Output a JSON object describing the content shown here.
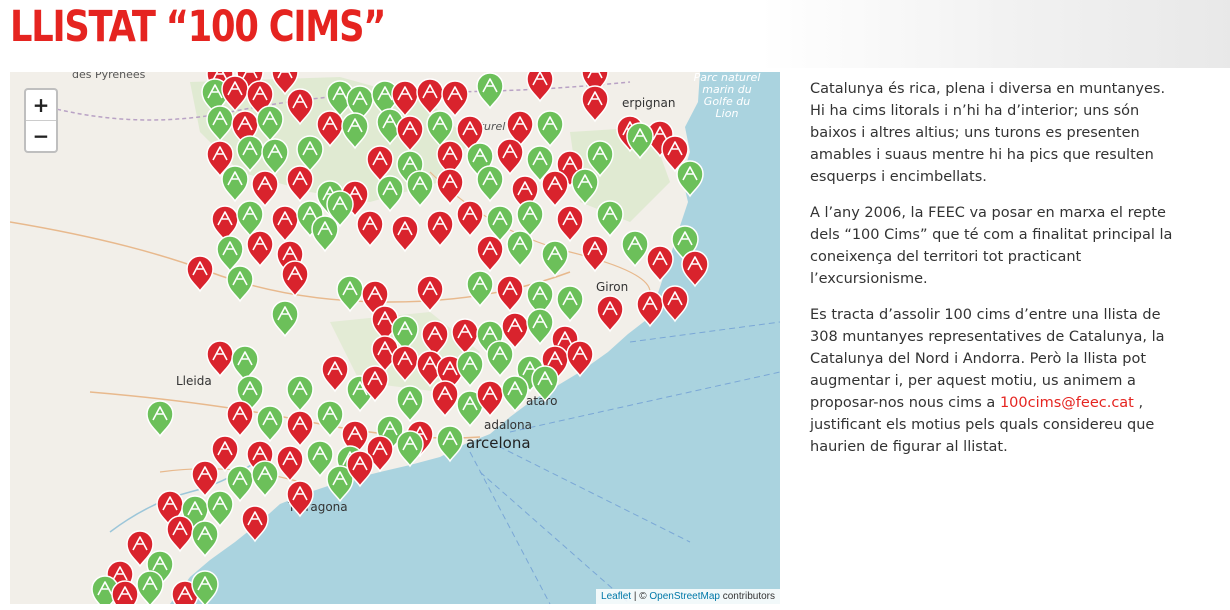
{
  "page": {
    "title": "LLISTAT “100 CIMS”"
  },
  "map": {
    "zoom_in_label": "+",
    "zoom_out_label": "−",
    "labels": {
      "pyrenees": "des Pyrénées",
      "parc_naturel_line1": "Parc naturel",
      "parc_naturel_line2": "marin du",
      "parc_naturel_line3": "Golfe du",
      "parc_naturel_line4": "Lion",
      "perpignan": "erpignan",
      "girona": "Giron",
      "lleida": "Lleida",
      "tarragona": "Tarragona",
      "barcelona": "arcelona",
      "mataro": "ataro",
      "badalona": "adalona",
      "naturel": "naturel"
    },
    "attribution": {
      "leaflet": "Leaflet",
      "separator": " | © ",
      "osm": "OpenStreetMap",
      "contributors": " contributors"
    },
    "marker_colors": {
      "red": "#d9232d",
      "green": "#6cc05a"
    }
  },
  "content": {
    "p1": "Catalunya és rica, plena i diversa en muntanyes. Hi ha cims litorals i n’hi ha d’interior; uns són baixos i altres altius; uns turons es presenten amables i suaus mentre hi ha pics que resulten esquerps i encimbellats.",
    "p2": "A l’any 2006, la FEEC va posar en marxa el repte dels “100 Cims” que té com a finalitat principal la coneixença del territori tot practicant l’excursionisme.",
    "p3_before": "Es tracta d’assolir 100 cims d’entre una llista de 308 muntanyes representatives de Catalunya, la Catalunya del Nord i Andorra. Però la llista pot augmentar i, per aquest motiu, us animem a proposar-nos nous cims a ",
    "p3_email": "100cims@feec.cat",
    "p3_after": " , justificant els motius pels quals considereu que haurien de figurar al llistat."
  }
}
